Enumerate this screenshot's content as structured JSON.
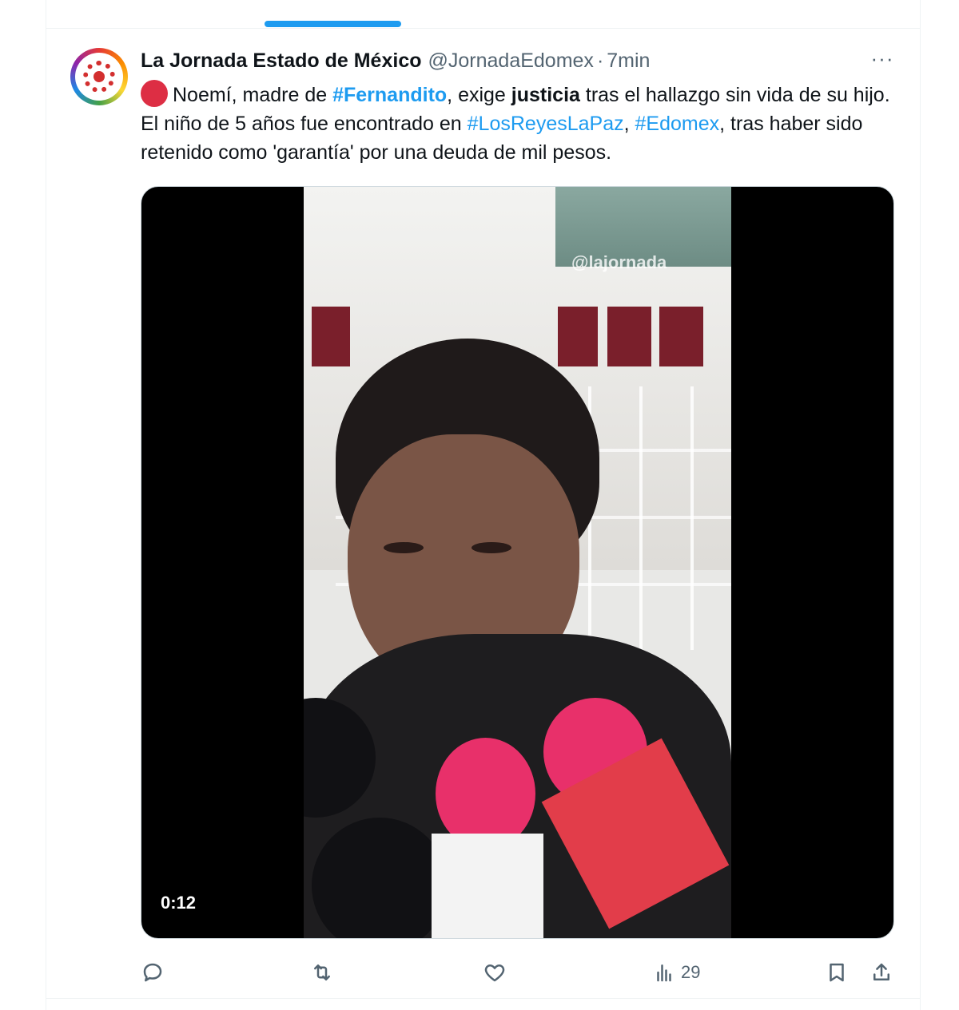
{
  "tweet": {
    "author_name": "La Jornada Estado de México",
    "author_handle": "@JornadaEdomex",
    "separator": "·",
    "timestamp": "7min",
    "more": "···",
    "text": {
      "part1": "Noemí, madre de ",
      "hashtag1": "#Fernandito",
      "part2": ", exige ",
      "bold1": "justicia",
      "part3": " tras el hallazgo sin vida de su hijo. El niño de 5 años fue encontrado en ",
      "hashtag2": "#LosReyesLaPaz",
      "part4": ", ",
      "hashtag3": "#Edomex",
      "part5": ", tras haber sido retenido como 'garantía' por una deuda de mil pesos."
    },
    "media": {
      "duration": "0:12",
      "watermark": "@lajornada"
    },
    "actions": {
      "reply_icon": "reply-icon",
      "retweet_icon": "retweet-icon",
      "like_icon": "heart-icon",
      "views_icon": "views-chart-icon",
      "views_count": "29",
      "bookmark_icon": "bookmark-icon",
      "share_icon": "share-icon"
    }
  },
  "colors": {
    "accent": "#1d9bf0",
    "text_primary": "#0f1419",
    "text_secondary": "#536471",
    "emoji_red": "#dd2e44"
  }
}
